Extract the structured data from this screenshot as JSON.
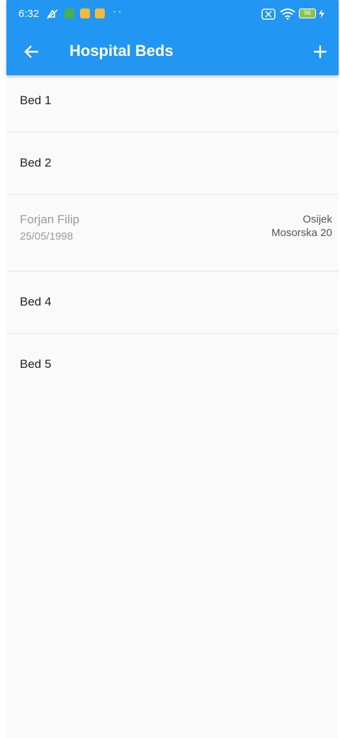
{
  "status_bar": {
    "time": "6:32",
    "battery": "96"
  },
  "toolbar": {
    "title": "Hospital Beds",
    "back_icon": "arrow-left-icon",
    "add_icon": "plus-icon"
  },
  "colors": {
    "primary": "#2196f3",
    "background": "#fafafa"
  },
  "beds": [
    {
      "label": "Bed 1"
    },
    {
      "label": "Bed 2"
    },
    {
      "occupant": {
        "name": "Forjan Filip",
        "dob": "25/05/1998",
        "city": "Osijek",
        "address": "Mosorska 20"
      }
    },
    {
      "label": "Bed 4"
    },
    {
      "label": "Bed 5"
    }
  ]
}
